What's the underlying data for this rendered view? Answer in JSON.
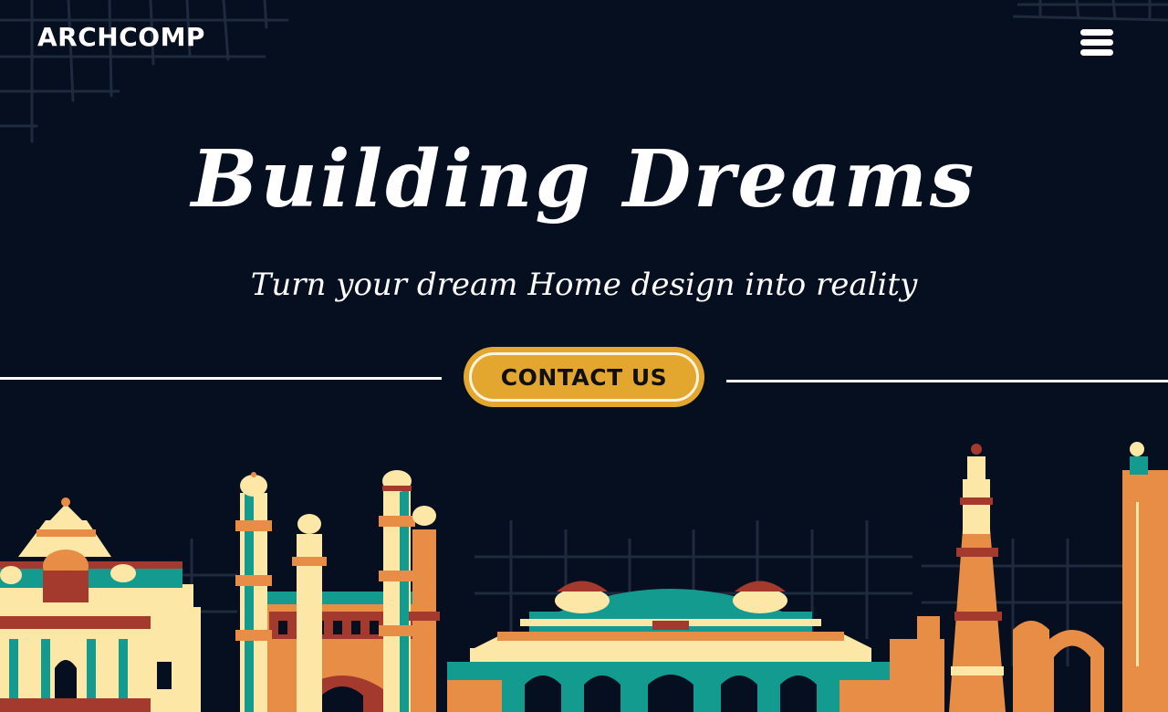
{
  "brand": {
    "name": "ARCHCOMP"
  },
  "nav": {
    "menu_icon": "hamburger-menu-icon"
  },
  "hero": {
    "title": "Building Dreams",
    "subtitle": "Turn your dream Home design into reality",
    "cta_label": "CONTACT US"
  },
  "colors": {
    "background": "#060f1f",
    "accent": "#e3a72f",
    "teal": "#139b8f",
    "cream": "#fde7a6",
    "orange": "#e88d45",
    "maroon": "#a33a2d"
  },
  "illustration": {
    "subject": "skyline-of-landmark-buildings"
  }
}
